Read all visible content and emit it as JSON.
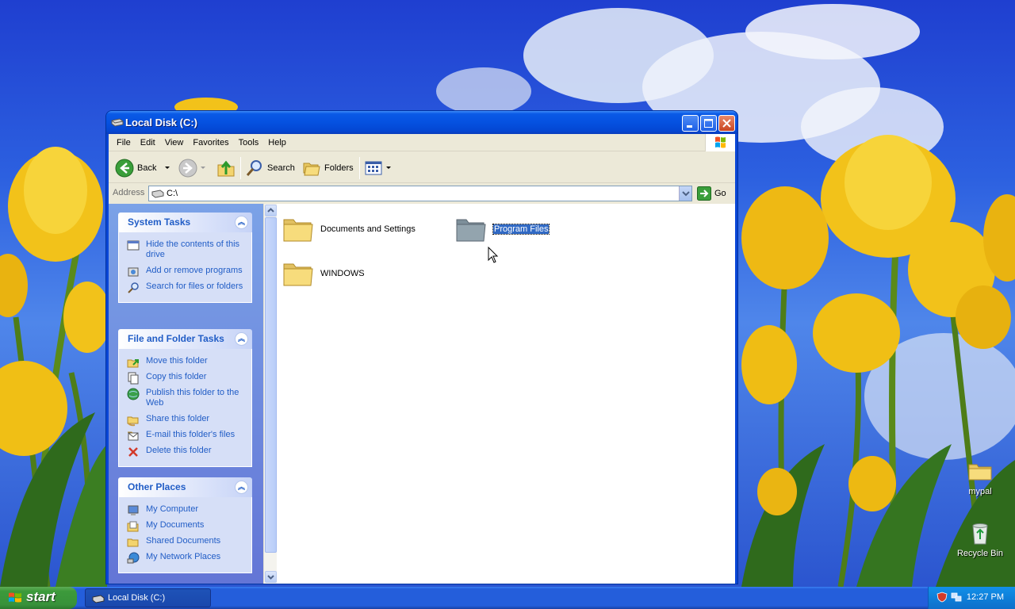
{
  "window": {
    "title": "Local Disk (C:)",
    "buttons": {
      "minimize": "minimize",
      "maximize": "maximize",
      "close": "close"
    }
  },
  "menubar": {
    "items": [
      "File",
      "Edit",
      "View",
      "Favorites",
      "Tools",
      "Help"
    ]
  },
  "toolbar": {
    "back_label": "Back",
    "search_label": "Search",
    "folders_label": "Folders"
  },
  "address": {
    "label": "Address",
    "value": "C:\\",
    "go_label": "Go"
  },
  "tasks": {
    "system": {
      "title": "System Tasks",
      "items": [
        {
          "label": "Hide the contents of this drive",
          "icon": "hide-contents-icon"
        },
        {
          "label": "Add or remove programs",
          "icon": "add-remove-programs-icon"
        },
        {
          "label": "Search for files or folders",
          "icon": "search-icon"
        }
      ]
    },
    "file_folder": {
      "title": "File and Folder Tasks",
      "items": [
        {
          "label": "Move this folder",
          "icon": "move-folder-icon"
        },
        {
          "label": "Copy this folder",
          "icon": "copy-folder-icon"
        },
        {
          "label": "Publish this folder to the Web",
          "icon": "publish-web-icon"
        },
        {
          "label": "Share this folder",
          "icon": "share-folder-icon"
        },
        {
          "label": "E-mail this folder's files",
          "icon": "email-icon"
        },
        {
          "label": "Delete this folder",
          "icon": "delete-icon"
        }
      ]
    },
    "other_places": {
      "title": "Other Places",
      "items": [
        {
          "label": "My Computer",
          "icon": "my-computer-icon"
        },
        {
          "label": "My Documents",
          "icon": "my-documents-icon"
        },
        {
          "label": "Shared Documents",
          "icon": "shared-documents-icon"
        },
        {
          "label": "My Network Places",
          "icon": "network-places-icon"
        }
      ]
    }
  },
  "files": [
    {
      "name": "Documents and Settings",
      "selected": false
    },
    {
      "name": "Program Files",
      "selected": true
    },
    {
      "name": "WINDOWS",
      "selected": false
    }
  ],
  "desktop_icons": [
    {
      "label": "mypal",
      "icon": "folder-icon"
    },
    {
      "label": "Recycle Bin",
      "icon": "recycle-bin-icon"
    }
  ],
  "taskbar": {
    "start_label": "start",
    "task_label": "Local Disk (C:)",
    "clock": "12:27 PM"
  },
  "colors": {
    "xp_blue": "#0a46d6",
    "taskpane_link": "#215dc6",
    "selection": "#316ac5",
    "start_green": "#3c9a3b"
  }
}
